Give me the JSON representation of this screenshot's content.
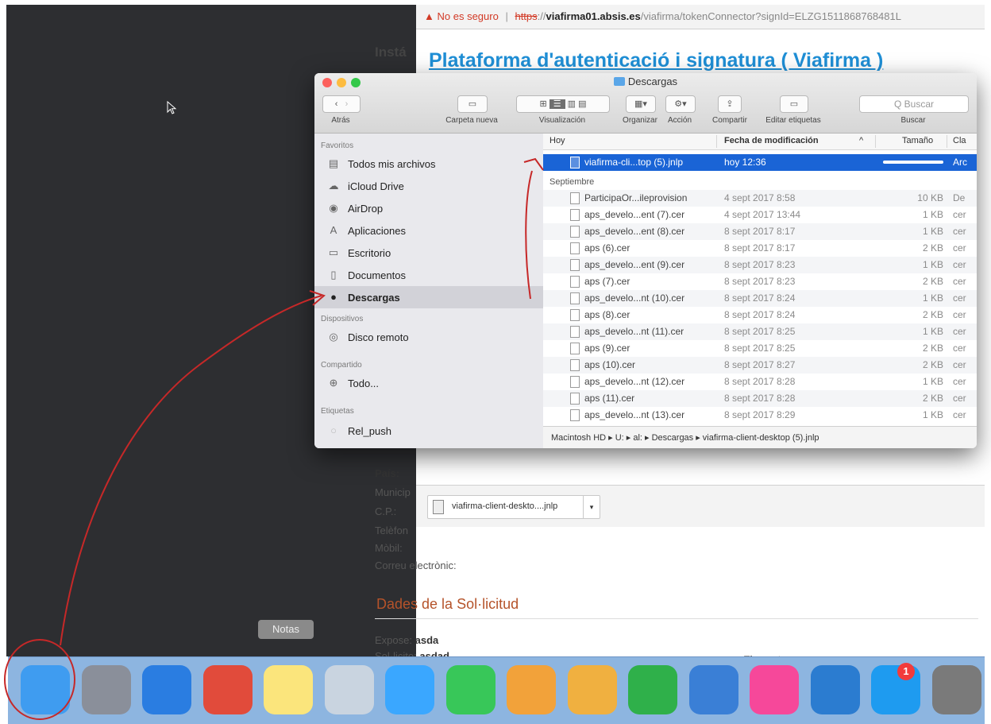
{
  "browser": {
    "security_warning": "No es seguro",
    "url_scheme": "https",
    "url_sep": "://",
    "url_host": "viafirma01.absis.es",
    "url_rest": "/viafirma/tokenConnector?signId=ELZG1511868768481L",
    "page_heading": "Plataforma d'autenticació i signatura ( Viafirma )",
    "bg_fragments": {
      "insta": "Instá",
      "pais_label": "País:",
      "municipi": "Municip",
      "cp_label": "C.P.:",
      "telefon": "Telèfon",
      "mobil": "Mòbil:",
      "correu": "Correu electrònic:",
      "section_title": "Dades de la Sol·licitud",
      "expose_label": "Expose:",
      "expose_value": "asda",
      "solicito_label": "Sol·licito:",
      "solicito_value": "asdad",
      "firmant": "Firmant"
    },
    "download": {
      "filename": "viafirma-client-deskto....jnlp",
      "menu_glyph": "▾"
    }
  },
  "finder": {
    "window_title": "Descargas",
    "toolbar": {
      "back_label": "Atrás",
      "new_folder_label": "Carpeta nueva",
      "view_label": "Visualización",
      "arrange_label": "Organizar",
      "action_label": "Acción",
      "share_label": "Compartir",
      "tags_label": "Editar etiquetas",
      "search_placeholder": "Q Buscar",
      "search_label": "Buscar"
    },
    "sidebar": {
      "favorites_header": "Favoritos",
      "favorites": [
        {
          "label": "Todos mis archivos",
          "icon": "all-files-icon"
        },
        {
          "label": "iCloud Drive",
          "icon": "cloud-icon"
        },
        {
          "label": "AirDrop",
          "icon": "airdrop-icon"
        },
        {
          "label": "Aplicaciones",
          "icon": "applications-icon"
        },
        {
          "label": "Escritorio",
          "icon": "desktop-icon"
        },
        {
          "label": "Documentos",
          "icon": "documents-icon"
        },
        {
          "label": "Descargas",
          "icon": "downloads-icon"
        }
      ],
      "devices_header": "Dispositivos",
      "devices": [
        {
          "label": "Disco remoto",
          "icon": "disc-icon"
        }
      ],
      "shared_header": "Compartido",
      "shared": [
        {
          "label": "Todo...",
          "icon": "network-icon"
        }
      ],
      "tags_header": "Etiquetas",
      "tags": [
        {
          "label": "Rel_push",
          "icon": "tag-icon"
        }
      ]
    },
    "columns": {
      "name": "Hoy",
      "date": "Fecha de modificación",
      "sort_glyph": "^",
      "size": "Tamaño",
      "kind": "Cla"
    },
    "today_files": [
      {
        "name": "viafirma-cli...top (5).jnlp",
        "date": "hoy 12:36",
        "kind": "Arc",
        "progress": 1.0
      }
    ],
    "group_header": "Septiembre",
    "files": [
      {
        "name": "ParticipaOr...ileprovision",
        "date": "4 sept 2017 8:58",
        "size": "10 KB",
        "kind": "De"
      },
      {
        "name": "aps_develo...ent (7).cer",
        "date": "4 sept 2017 13:44",
        "size": "1 KB",
        "kind": "cer"
      },
      {
        "name": "aps_develo...ent (8).cer",
        "date": "8 sept 2017 8:17",
        "size": "1 KB",
        "kind": "cer"
      },
      {
        "name": "aps (6).cer",
        "date": "8 sept 2017 8:17",
        "size": "2 KB",
        "kind": "cer"
      },
      {
        "name": "aps_develo...ent (9).cer",
        "date": "8 sept 2017 8:23",
        "size": "1 KB",
        "kind": "cer"
      },
      {
        "name": "aps (7).cer",
        "date": "8 sept 2017 8:23",
        "size": "2 KB",
        "kind": "cer"
      },
      {
        "name": "aps_develo...nt (10).cer",
        "date": "8 sept 2017 8:24",
        "size": "1 KB",
        "kind": "cer"
      },
      {
        "name": "aps (8).cer",
        "date": "8 sept 2017 8:24",
        "size": "2 KB",
        "kind": "cer"
      },
      {
        "name": "aps_develo...nt (11).cer",
        "date": "8 sept 2017 8:25",
        "size": "1 KB",
        "kind": "cer"
      },
      {
        "name": "aps (9).cer",
        "date": "8 sept 2017 8:25",
        "size": "2 KB",
        "kind": "cer"
      },
      {
        "name": "aps (10).cer",
        "date": "8 sept 2017 8:27",
        "size": "2 KB",
        "kind": "cer"
      },
      {
        "name": "aps_develo...nt (12).cer",
        "date": "8 sept 2017 8:28",
        "size": "1 KB",
        "kind": "cer"
      },
      {
        "name": "aps (11).cer",
        "date": "8 sept 2017 8:28",
        "size": "2 KB",
        "kind": "cer"
      },
      {
        "name": "aps_develo...nt (13).cer",
        "date": "8 sept 2017 8:29",
        "size": "1 KB",
        "kind": "cer"
      }
    ],
    "path_bar": "Macintosh HD ▸ U: ▸ al: ▸ Descargas ▸ viafirma-client-desktop (5).jnlp"
  },
  "dock": {
    "tooltip": "Notas",
    "appstore_badge": "1",
    "apps": [
      {
        "name": "finder-icon",
        "color": "#3f9cf0"
      },
      {
        "name": "launchpad-icon",
        "color": "#8a8f9a"
      },
      {
        "name": "safari-icon",
        "color": "#2a7de1"
      },
      {
        "name": "chrome-icon",
        "color": "#e14b3b"
      },
      {
        "name": "notes-icon",
        "color": "#fbe57c"
      },
      {
        "name": "preview-icon",
        "color": "#c9d4e0"
      },
      {
        "name": "messages-icon",
        "color": "#3aa7ff"
      },
      {
        "name": "facetime-icon",
        "color": "#38c759"
      },
      {
        "name": "photos-icon",
        "color": "#f2a23a"
      },
      {
        "name": "pages-icon",
        "color": "#f0b040"
      },
      {
        "name": "numbers-icon",
        "color": "#2fb04a"
      },
      {
        "name": "keynote-icon",
        "color": "#3a7fd6"
      },
      {
        "name": "itunes-icon",
        "color": "#f6489a"
      },
      {
        "name": "xcode-icon",
        "color": "#2b7cd0"
      },
      {
        "name": "appstore-icon",
        "color": "#1e9bf0"
      },
      {
        "name": "system-preferences-icon",
        "color": "#7a7a7a"
      }
    ]
  },
  "annotation_color": "#c62828"
}
